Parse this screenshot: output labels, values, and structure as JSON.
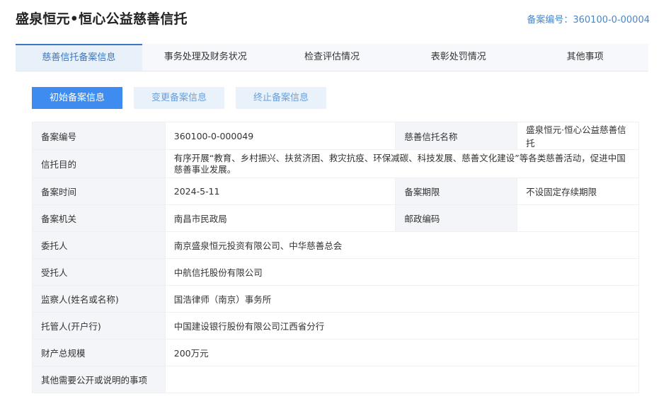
{
  "header": {
    "title": "盛泉恒元•恒心公益慈善信托",
    "record_no_label": "备案编号：360100-0-00004"
  },
  "tabs": [
    {
      "label": "慈善信托备案信息",
      "active": true
    },
    {
      "label": "事务处理及财务状况",
      "active": false
    },
    {
      "label": "检查评估情况",
      "active": false
    },
    {
      "label": "表彰处罚情况",
      "active": false
    },
    {
      "label": "其他事项",
      "active": false
    }
  ],
  "subtabs": [
    {
      "label": "初始备案信息",
      "active": true
    },
    {
      "label": "变更备案信息",
      "active": false
    },
    {
      "label": "终止备案信息",
      "active": false
    }
  ],
  "info": {
    "record_no_label": "备案编号",
    "record_no_value": "360100-0-000049",
    "trust_name_label": "慈善信托名称",
    "trust_name_value": "盛泉恒元·恒心公益慈善信托",
    "purpose_label": "信托目的",
    "purpose_value": "有序开展“教育、乡村振兴、扶贫济困、救灾抗疫、环保减碳、科技发展、慈善文化建设”等各类慈善活动，促进中国慈善事业发展。",
    "record_time_label": "备案时间",
    "record_time_value": "2024-5-11",
    "record_period_label": "备案期限",
    "record_period_value": "不设固定存续期限",
    "record_org_label": "备案机关",
    "record_org_value": "南昌市民政局",
    "postal_label": "邮政编码",
    "postal_value": "",
    "settlor_label": "委托人",
    "settlor_value": "南京盛泉恒元投资有限公司、中华慈善总会",
    "trustee_label": "受托人",
    "trustee_value": "中航信托股份有限公司",
    "supervisor_label": "监察人(姓名或名称)",
    "supervisor_value": "国浩律师（南京）事务所",
    "custodian_label": "托管人(开户行)",
    "custodian_value": "中国建设银行股份有限公司江西省分行",
    "assets_label": "财产总规模",
    "assets_value": "200万元",
    "other_label": "其他需要公开或说明的事项",
    "other_value": ""
  }
}
